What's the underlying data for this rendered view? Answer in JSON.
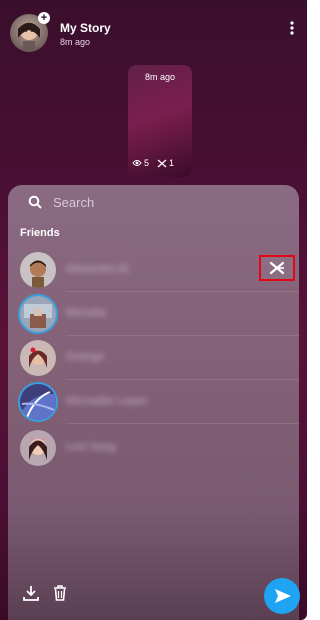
{
  "header": {
    "title": "My Story",
    "time": "8m ago"
  },
  "thumbnail": {
    "time": "8m ago",
    "views": "5",
    "screenshots": "1"
  },
  "search": {
    "placeholder": "Search"
  },
  "friends": {
    "heading": "Friends",
    "items": [
      {
        "name": "Alexandra M.",
        "ring": false
      },
      {
        "name": "Morrelia",
        "ring": true
      },
      {
        "name": "Rodrigo",
        "ring": false
      },
      {
        "name": "Mercedes Lopez",
        "ring": true
      },
      {
        "name": "Leni Sang",
        "ring": false
      }
    ]
  },
  "icons": {
    "more": "more-vertical-icon",
    "search": "search-icon",
    "download": "download-icon",
    "delete": "trash-icon",
    "send": "send-arrow-icon",
    "replay": "screenshot-icon"
  },
  "colors": {
    "background_dark": "#3a0f2c",
    "panel": "#836177",
    "accent_blue": "#1ea4f2",
    "highlight_red": "#e30613"
  }
}
